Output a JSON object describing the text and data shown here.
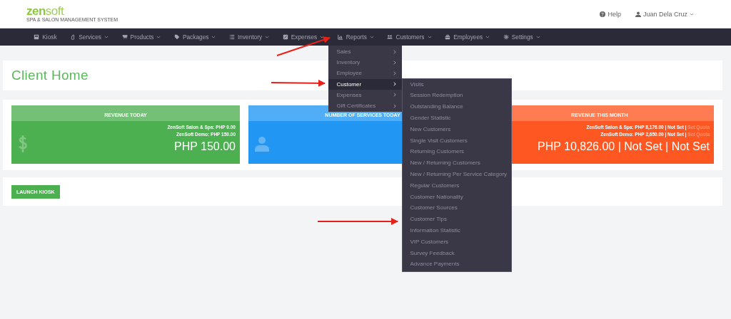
{
  "logo": {
    "bold": "zen",
    "light": "soft",
    "tagline": "SPA & SALON MANAGEMENT SYSTEM"
  },
  "header_links": [
    {
      "label": "Help",
      "dropdown": false
    },
    {
      "label": "Juan Dela Cruz",
      "dropdown": true
    }
  ],
  "nav": [
    {
      "label": "Kiosk",
      "dropdown": false,
      "open": false
    },
    {
      "label": "Services",
      "dropdown": true,
      "open": false
    },
    {
      "label": "Products",
      "dropdown": true,
      "open": false
    },
    {
      "label": "Packages",
      "dropdown": true,
      "open": false
    },
    {
      "label": "Inventory",
      "dropdown": true,
      "open": false
    },
    {
      "label": "Expenses",
      "dropdown": true,
      "open": false
    },
    {
      "label": "Reports",
      "dropdown": true,
      "open": true,
      "menu": [
        {
          "label": "Sales",
          "selected": false
        },
        {
          "label": "Inventory",
          "selected": false
        },
        {
          "label": "Employee",
          "selected": false
        },
        {
          "label": "Customer",
          "selected": true,
          "children": [
            {
              "label": "Visits"
            },
            {
              "label": "Session Redemption"
            },
            {
              "label": "Outstanding Balance"
            },
            {
              "label": "Gender Statistic"
            },
            {
              "label": "New Customers"
            },
            {
              "label": "Single Visit Customers"
            },
            {
              "label": "Returning Customers"
            },
            {
              "label": "New / Returning Customers"
            },
            {
              "label": "New / Returning Per Service Category"
            },
            {
              "label": "Regular Customers"
            },
            {
              "label": "Customer Nationality"
            },
            {
              "label": "Customer Sources"
            },
            {
              "label": "Customer Tips"
            },
            {
              "label": "Information Statistic"
            },
            {
              "label": "VIP Customers"
            },
            {
              "label": "Survey Feedback"
            },
            {
              "label": "Advance Payments"
            }
          ]
        },
        {
          "label": "Expenses",
          "selected": false
        },
        {
          "label": "Gift Certificates",
          "selected": false
        }
      ]
    },
    {
      "label": "Customers",
      "dropdown": true,
      "open": false
    },
    {
      "label": "Employees",
      "dropdown": true,
      "open": false
    },
    {
      "label": "Settings",
      "dropdown": true,
      "open": false
    }
  ],
  "page_title": "Client Home",
  "cards": [
    {
      "title": "REVENUE TODAY",
      "kind": "currency",
      "color": "#4caf50",
      "lines": [
        {
          "text": "ZenSoft Salon & Spa: PHP 0.00"
        },
        {
          "text": "ZenSoft Demo: PHP 150.00"
        }
      ],
      "total": "PHP 150.00"
    },
    {
      "title": "NUMBER OF SERVICES TODAY",
      "kind": "person",
      "color": "#2196f3"
    },
    {
      "title": "REVENUE THIS MONTH",
      "kind": "plain",
      "color": "#ff5722",
      "lines": [
        {
          "text": "ZenSoft Salon & Spa: PHP 8,176.00 | Not Set |",
          "link": "Set Quota"
        },
        {
          "text": "ZenSoft Demo: PHP 2,650.00 | Not Set |",
          "link": "Set Quota"
        }
      ],
      "total": "PHP 10,826.00 | Not Set | Not Set"
    }
  ],
  "launch_button": "LAUNCH KIOSK"
}
